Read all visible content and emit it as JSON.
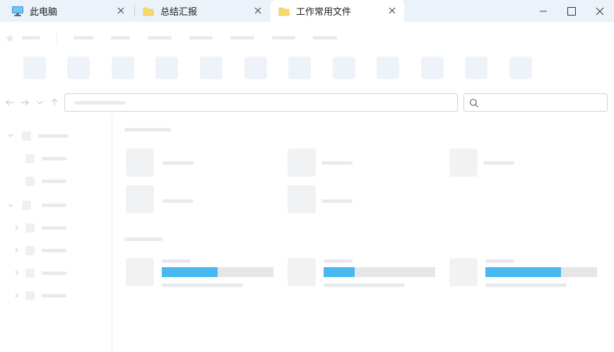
{
  "tabs": [
    {
      "label": "此电脑",
      "icon": "monitor-icon",
      "active": false
    },
    {
      "label": "总结汇报",
      "icon": "folder-icon",
      "active": false
    },
    {
      "label": "工作常用文件",
      "icon": "folder-icon",
      "active": true
    }
  ],
  "window_controls": [
    "minimize-icon",
    "maximize-icon",
    "close-icon"
  ],
  "colors": {
    "titlebar": "#ecf2f9",
    "folder_icon": "#f7d96b",
    "drive_fill": "#47b9f0",
    "drive_track": "#e6e6e6"
  },
  "drives": [
    {
      "used_fraction": 0.5
    },
    {
      "used_fraction": 0.28
    },
    {
      "used_fraction": 0.68
    }
  ]
}
